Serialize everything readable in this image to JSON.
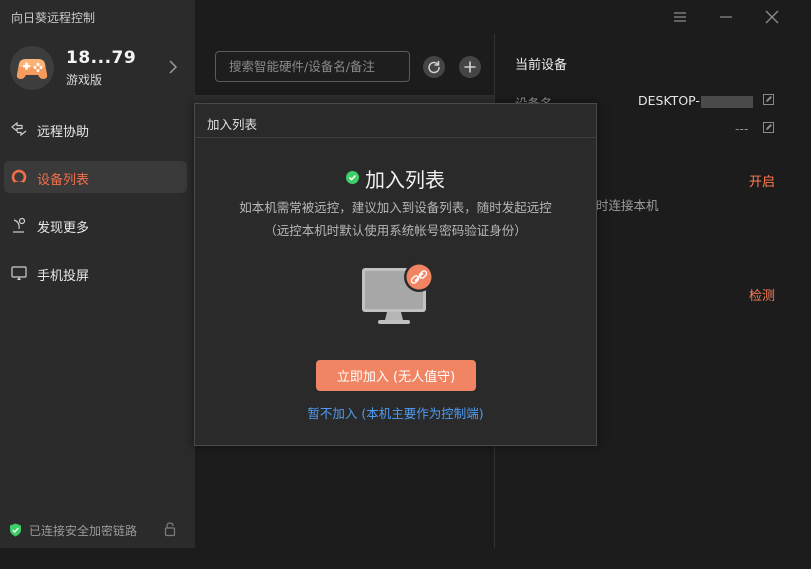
{
  "window": {
    "title": "向日葵远程控制"
  },
  "profile": {
    "name": "18...79",
    "edition": "游戏版"
  },
  "nav": {
    "items": [
      {
        "label": "远程协助",
        "icon": "remote-assist-icon"
      },
      {
        "label": "设备列表",
        "icon": "device-list-icon",
        "active": true
      },
      {
        "label": "发现更多",
        "icon": "discover-icon"
      },
      {
        "label": "手机投屏",
        "icon": "screen-cast-icon"
      }
    ]
  },
  "footer": {
    "secure_text": "已连接安全加密链路"
  },
  "search": {
    "placeholder": "搜索智能硬件/设备名/备注"
  },
  "right_panel": {
    "title": "当前设备",
    "device_name_label": "设备名",
    "device_name_value": "DESKTOP-",
    "remark_value": "---",
    "enable_text": "开启",
    "partial_text": "时连接本机",
    "check_text": "检测"
  },
  "modal": {
    "header_title": "加入列表",
    "heading": "加入列表",
    "desc_line1": "如本机需常被远控，建议加入到设备列表，随时发起远控",
    "desc_line2": "（远控本机时默认使用系统帐号密码验证身份）",
    "primary_button": "立即加入 (无人值守)",
    "secondary_link": "暂不加入 (本机主要作为控制端)"
  },
  "colors": {
    "accent": "#f06f4a",
    "button": "#f18563",
    "link": "#4f9bf0",
    "success": "#3ecf6a"
  }
}
